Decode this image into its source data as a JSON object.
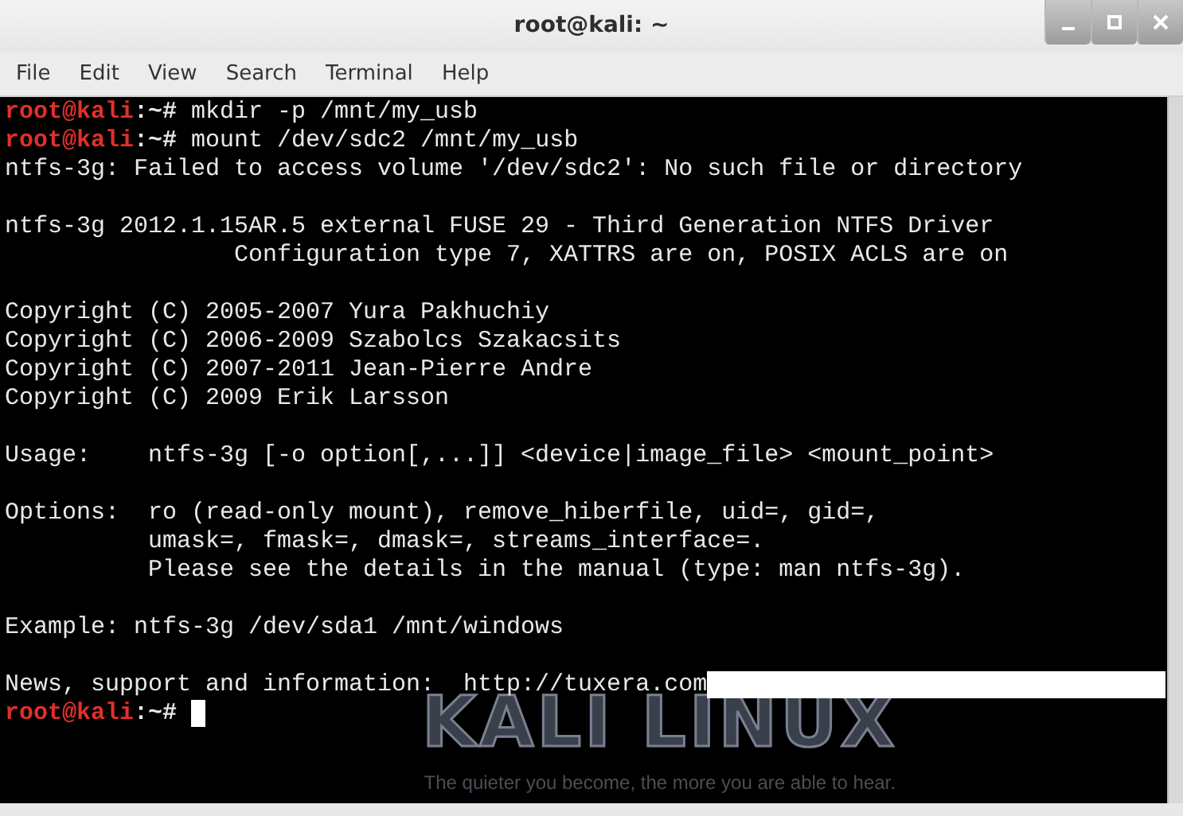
{
  "window": {
    "title": "root@kali: ~"
  },
  "menu": [
    "File",
    "Edit",
    "View",
    "Search",
    "Terminal",
    "Help"
  ],
  "wallpaper": {
    "logo_text": "KALI LINUX",
    "tagline": "The quieter you become, the more you are able to hear."
  },
  "terminal": {
    "lines": [
      {
        "kind": "prompt",
        "user": "root@kali",
        "path": ":~#",
        "command": " mkdir -p /mnt/my_usb"
      },
      {
        "kind": "prompt",
        "user": "root@kali",
        "path": ":~#",
        "command": " mount /dev/sdc2 /mnt/my_usb"
      },
      {
        "kind": "output",
        "text": "ntfs-3g: Failed to access volume '/dev/sdc2': No such file or directory",
        "highlight": false
      },
      {
        "kind": "blank"
      },
      {
        "kind": "output",
        "text": "ntfs-3g 2012.1.15AR.5 external FUSE 29 - Third Generation NTFS Driver",
        "highlight": false
      },
      {
        "kind": "output",
        "text": "                Configuration type 7, XATTRS are on, POSIX ACLS are on",
        "highlight": false
      },
      {
        "kind": "blank"
      },
      {
        "kind": "output",
        "text": "Copyright (C) 2005-2007 Yura Pakhuchiy",
        "highlight": false
      },
      {
        "kind": "output",
        "text": "Copyright (C) 2006-2009 Szabolcs Szakacsits",
        "highlight": false
      },
      {
        "kind": "output",
        "text": "Copyright (C) 2007-2011 Jean-Pierre Andre",
        "highlight": false
      },
      {
        "kind": "output",
        "text": "Copyright (C) 2009 Erik Larsson",
        "highlight": false
      },
      {
        "kind": "blank"
      },
      {
        "kind": "output",
        "text": "Usage:    ntfs-3g [-o option[,...]] <device|image_file> <mount_point>",
        "highlight": false
      },
      {
        "kind": "blank"
      },
      {
        "kind": "output",
        "text": "Options:  ro (read-only mount), remove_hiberfile, uid=, gid=,",
        "highlight": false
      },
      {
        "kind": "output",
        "text": "          umask=, fmask=, dmask=, streams_interface=.",
        "highlight": false
      },
      {
        "kind": "output",
        "text": "          Please see the details in the manual (type: man ntfs-3g).",
        "highlight": false
      },
      {
        "kind": "blank"
      },
      {
        "kind": "output",
        "text": "Example: ntfs-3g /dev/sda1 /mnt/windows",
        "highlight": false
      },
      {
        "kind": "blank"
      },
      {
        "kind": "output",
        "text": "News, support and information:  http://tuxera.com",
        "highlight": true
      },
      {
        "kind": "prompt",
        "user": "root@kali",
        "path": ":~#",
        "cursor": true
      }
    ]
  }
}
